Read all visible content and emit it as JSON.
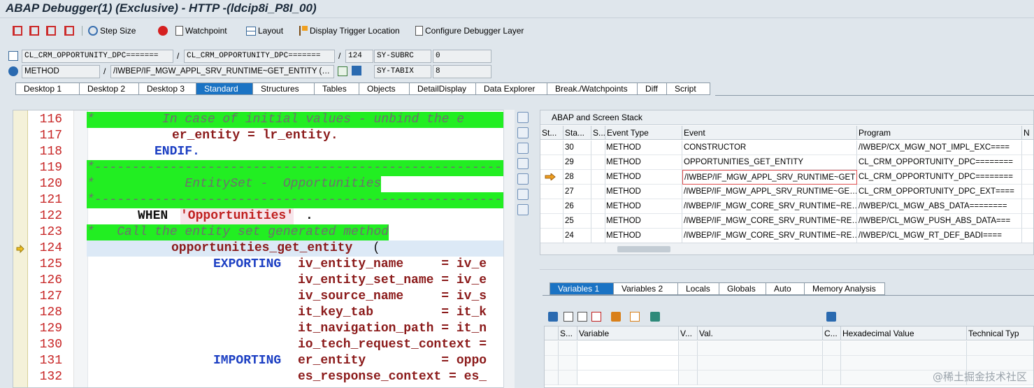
{
  "window": {
    "title": "ABAP Debugger(1)  (Exclusive) - HTTP -(ldcip8i_P8I_00)"
  },
  "toolbar": {
    "items": [
      {
        "label": "Step Size",
        "icon": "step-size-icon"
      },
      {
        "label": "Watchpoint",
        "icon": "watchpoint-icon"
      },
      {
        "label": "Layout",
        "icon": "layout-icon"
      },
      {
        "label": "Display Trigger Location",
        "icon": "trigger-location-icon"
      },
      {
        "label": "Configure Debugger Layer",
        "icon": "configure-layer-icon"
      }
    ],
    "stop_icon": "stop-icon"
  },
  "status": {
    "program1": "CL_CRM_OPPORTUNITY_DPC=======",
    "program2": "CL_CRM_OPPORTUNITY_DPC=======",
    "line": "124",
    "sysubrc_label": "SY-SUBRC",
    "sysubrc_value": "0",
    "event_type": "METHOD",
    "event": "/IWBEP/IF_MGW_APPL_SRV_RUNTIME~GET_ENTITY (…",
    "sytabix_label": "SY-TABIX",
    "sytabix_value": "8",
    "sep1": "/",
    "sep2": "/",
    "sep3": "/"
  },
  "tabs": [
    "Desktop 1",
    "Desktop 2",
    "Desktop 3",
    "Standard",
    "Structures",
    "Tables",
    "Objects",
    "DetailDisplay",
    "Data Explorer",
    "Break./Watchpoints",
    "Diff",
    "Script"
  ],
  "active_tab": "Standard",
  "code": {
    "current_line": "124",
    "lines": [
      {
        "no": "116",
        "text": "*         In case of initial values - unbind the e"
      },
      {
        "no": "117",
        "text": "er_entity = lr_entity."
      },
      {
        "no": "118",
        "text": "ENDIF."
      },
      {
        "no": "119",
        "text": "*-------------------------------------------------------------"
      },
      {
        "no": "120",
        "text": "*            EntitySet -  Opportunities"
      },
      {
        "no": "121",
        "text": "*-------------------------------------------------------------"
      },
      {
        "no": "122",
        "text_kw": "WHEN",
        "text_str": "'Opportunities'",
        "text_end": "."
      },
      {
        "no": "123",
        "text": "*   Call the entity set generated method"
      },
      {
        "no": "124",
        "text": "opportunities_get_entity",
        "text_end": "("
      },
      {
        "no": "125",
        "text_kw": "EXPORTING",
        "text": "iv_entity_name     = iv_e"
      },
      {
        "no": "126",
        "text": "iv_entity_set_name = iv_e"
      },
      {
        "no": "127",
        "text": "iv_source_name     = iv_s"
      },
      {
        "no": "128",
        "text": "it_key_tab         = it_k"
      },
      {
        "no": "129",
        "text": "it_navigation_path = it_n"
      },
      {
        "no": "130",
        "text": "io_tech_request_context ="
      },
      {
        "no": "131",
        "text_kw": "IMPORTING",
        "text": "er_entity          = oppo"
      },
      {
        "no": "132",
        "text": "es_response_context = es_"
      }
    ]
  },
  "stack": {
    "title": "ABAP and Screen Stack",
    "headers": [
      "St...",
      "Sta...",
      "S...",
      "Event Type",
      "Event",
      "Program",
      "N"
    ],
    "rows": [
      {
        "sta": "30",
        "type": "METHOD",
        "event": "CONSTRUCTOR",
        "program": "/IWBEP/CX_MGW_NOT_IMPL_EXC===="
      },
      {
        "sta": "29",
        "type": "METHOD",
        "event": "OPPORTUNITIES_GET_ENTITY",
        "program": "CL_CRM_OPPORTUNITY_DPC========"
      },
      {
        "sta": "28",
        "type": "METHOD",
        "event": "/IWBEP/IF_MGW_APPL_SRV_RUNTIME~GET",
        "program": "CL_CRM_OPPORTUNITY_DPC========",
        "current": true
      },
      {
        "sta": "27",
        "type": "METHOD",
        "event": "/IWBEP/IF_MGW_APPL_SRV_RUNTIME~GE…",
        "program": "CL_CRM_OPPORTUNITY_DPC_EXT===="
      },
      {
        "sta": "26",
        "type": "METHOD",
        "event": "/IWBEP/IF_MGW_CORE_SRV_RUNTIME~RE…",
        "program": "/IWBEP/CL_MGW_ABS_DATA========"
      },
      {
        "sta": "25",
        "type": "METHOD",
        "event": "/IWBEP/IF_MGW_CORE_SRV_RUNTIME~RE…",
        "program": "/IWBEP/CL_MGW_PUSH_ABS_DATA==="
      },
      {
        "sta": "24",
        "type": "METHOD",
        "event": "/IWBEP/IF_MGW_CORE_SRV_RUNTIME~RE…",
        "program": "/IWBEP/CL_MGW_RT_DEF_BADI===="
      }
    ]
  },
  "var_tabs": [
    "Variables 1",
    "Variables 2",
    "Locals",
    "Globals",
    "Auto",
    "Memory Analysis"
  ],
  "active_var_tab": "Variables 1",
  "vars": {
    "headers": [
      "S...",
      "Variable",
      "V...",
      "Val.",
      "C...",
      "Hexadecimal Value",
      "Technical Typ"
    ]
  },
  "watermark": "@稀土掘金技术社区"
}
